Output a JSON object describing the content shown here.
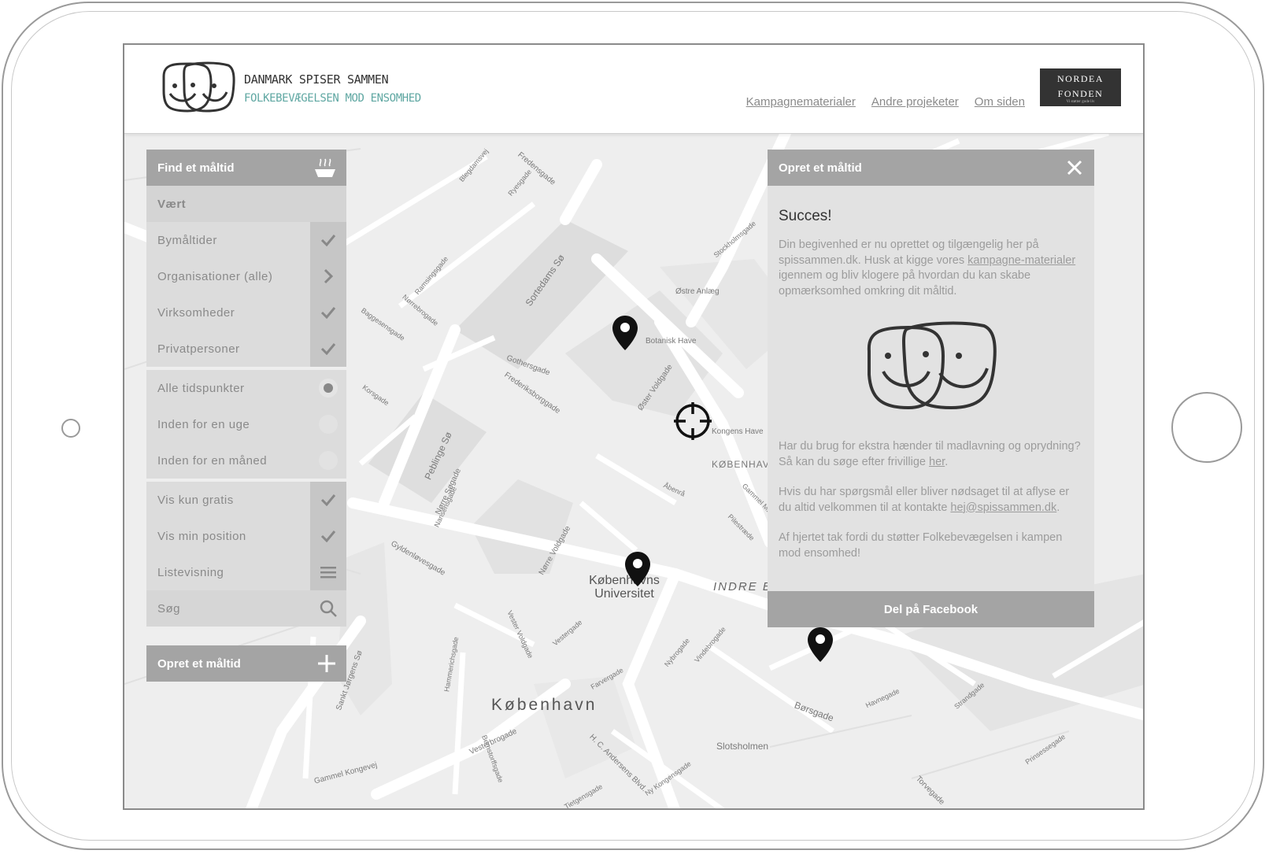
{
  "header": {
    "brand_title": "DANMARK SPISER SAMMEN",
    "brand_subtitle": "FOLKEBEVÆGELSEN MOD ENSOMHED",
    "nav": [
      "Kampagnematerialer",
      "Andre projeketer",
      "Om siden"
    ],
    "sponsor_line1": "NORDEA",
    "sponsor_line2": "FONDEN",
    "sponsor_tagline": "Vi støtter gode liv"
  },
  "left_panel": {
    "title": "Find et måltid",
    "host_label": "Vært",
    "host_filters": [
      {
        "label": "Bymåltider",
        "control": "check"
      },
      {
        "label": "Organisationer (alle)",
        "control": "chevron"
      },
      {
        "label": "Virksomheder",
        "control": "check"
      },
      {
        "label": "Privatpersoner",
        "control": "check"
      }
    ],
    "time_filters": [
      {
        "label": "Alle tidspunkter",
        "selected": true
      },
      {
        "label": "Inden for en uge",
        "selected": false
      },
      {
        "label": "Inden for en måned",
        "selected": false
      }
    ],
    "option_filters": [
      {
        "label": "Vis kun gratis",
        "control": "check"
      },
      {
        "label": "Vis min position",
        "control": "check"
      },
      {
        "label": "Listevisning",
        "control": "list"
      }
    ],
    "search_label": "Søg",
    "create_label": "Opret et måltid"
  },
  "right_panel": {
    "title": "Opret et måltid",
    "heading": "Succes!",
    "p1_before": "Din begivenhed er nu oprettet og tilgængelig her på spissammen.dk. Husk at kigge vores ",
    "p1_link": "kampagne-materialer",
    "p1_after": " igennem og bliv klogere på hvordan du kan skabe opmærksomhed omkring dit måltid.",
    "p2_before": "Har du brug for ekstra hænder til madlavning og oprydning? Så kan du søge efter frivillige ",
    "p2_link": "her",
    "p2_after": ".",
    "p3_before": "Hvis du har spørgsmål eller bliver nødsaget til at aflyse er du altid velkommen til at kontakte ",
    "p3_link": "hej@spissammen.dk",
    "p3_after": ".",
    "p4": "Af hjertet tak fordi du støtter Folkebevægelsen i kampen mod ensomhed!",
    "share_label": "Del på Facebook"
  },
  "map": {
    "labels": {
      "university": "Københavns Universitet",
      "city": "København",
      "indre": "INDRE BY",
      "botanisk": "Botanisk Have",
      "kongens": "Kongens Have",
      "kbh_k": "KØBENHAVN K",
      "slotsholmen": "Slotsholmen",
      "borsgade": "Børsgade",
      "ostre_anlaeg": "Østre Anlæg",
      "sortedams": "Sortedams Sø",
      "peblinge": "Peblinge Sø",
      "norre_sogade": "Nørre Søgade",
      "frederiksborggade": "Frederiksborggade",
      "gothersgade": "Gothersgade",
      "oster_voldgade": "Øster Voldgade",
      "norre_voldgade": "Nørre Voldgade",
      "vesterbrogade": "Vesterbrogade",
      "gyldenlovesgade": "Gyldenløvesgade",
      "hc_andersens": "H. C. Andersens Blvd.",
      "ny_kongensgade": "Ny Kongensgade",
      "vester_voldgade": "Vester Voldgade",
      "gammel_kongevej": "Gammel Kongevej",
      "torvegade": "Torvegade",
      "havnegade": "Havnegade",
      "stockholmsgade": "Stockholmsgade",
      "fredensgade": "Fredensgade",
      "ryesgade": "Ryesgade",
      "blegdamsvej": "Blegdamsvej",
      "baggesensgade": "Baggesensgade",
      "norrebrogade": "Nørrebrogade",
      "ramsingsgade": "Ramsingsgade",
      "korsgade": "Korsgade",
      "nansensgade": "Nansensgade",
      "hammerichsgade": "Hammerichsgade",
      "vestergade": "Vestergade",
      "farvergade": "Farvergade",
      "nybrogade": "Nybrogade",
      "vindebrogade": "Vindebrogade",
      "sankt_jorgens_so": "Sankt Jørgens Sø",
      "bernstorffsgade": "Bernstorffsgade",
      "tietgensgade": "Tietgensgade",
      "strandgade": "Strandgade",
      "prinsessegade": "Prinsessegade",
      "abenra": "Åbenrå",
      "pilestraede": "Pilestræde",
      "gammel_mont": "Gammel Mønt"
    }
  },
  "colors": {
    "panel_header": "#a4a4a4",
    "panel_bg": "#dcdcdc",
    "accent_teal": "#5fa7a2",
    "map_bg": "#efefef"
  }
}
